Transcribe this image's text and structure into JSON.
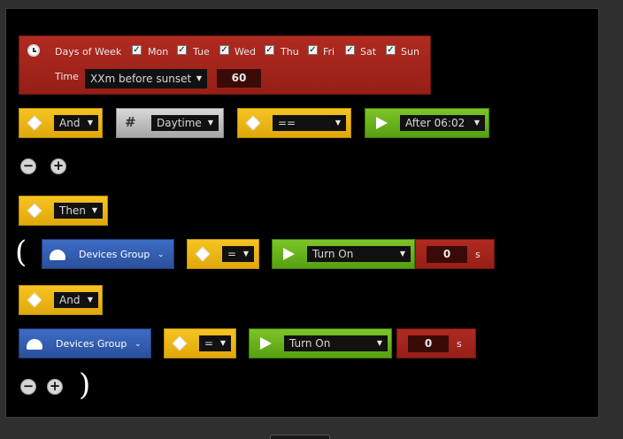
{
  "schedule": {
    "days_label": "Days of Week",
    "days": [
      {
        "label": "Mon",
        "checked": true
      },
      {
        "label": "Tue",
        "checked": true
      },
      {
        "label": "Wed",
        "checked": true
      },
      {
        "label": "Thu",
        "checked": true
      },
      {
        "label": "Fri",
        "checked": true
      },
      {
        "label": "Sat",
        "checked": true
      },
      {
        "label": "Sun",
        "checked": true
      }
    ],
    "time_label": "Time",
    "time_select": "XXm before sunset",
    "time_value": "60"
  },
  "condition_row": {
    "operator": "And",
    "variable": "Daytime",
    "comparison": "==",
    "value": "After 06:02"
  },
  "buttons": {
    "minus": "−",
    "plus": "+"
  },
  "then_label": "Then",
  "action1": {
    "paren": "(",
    "device": "Devices Group",
    "comparison": "=",
    "action": "Turn On",
    "delay_value": "0",
    "delay_unit": "s"
  },
  "and_label": "And",
  "action2": {
    "device": "Devices Group",
    "comparison": "=",
    "action": "Turn On",
    "delay_value": "0",
    "delay_unit": "s",
    "paren": ")"
  },
  "colors": {
    "yellow": "#e9b516",
    "green": "#6bb51f",
    "blue": "#3560b2",
    "red": "#a8261d",
    "grey": "#c2c2c2"
  }
}
